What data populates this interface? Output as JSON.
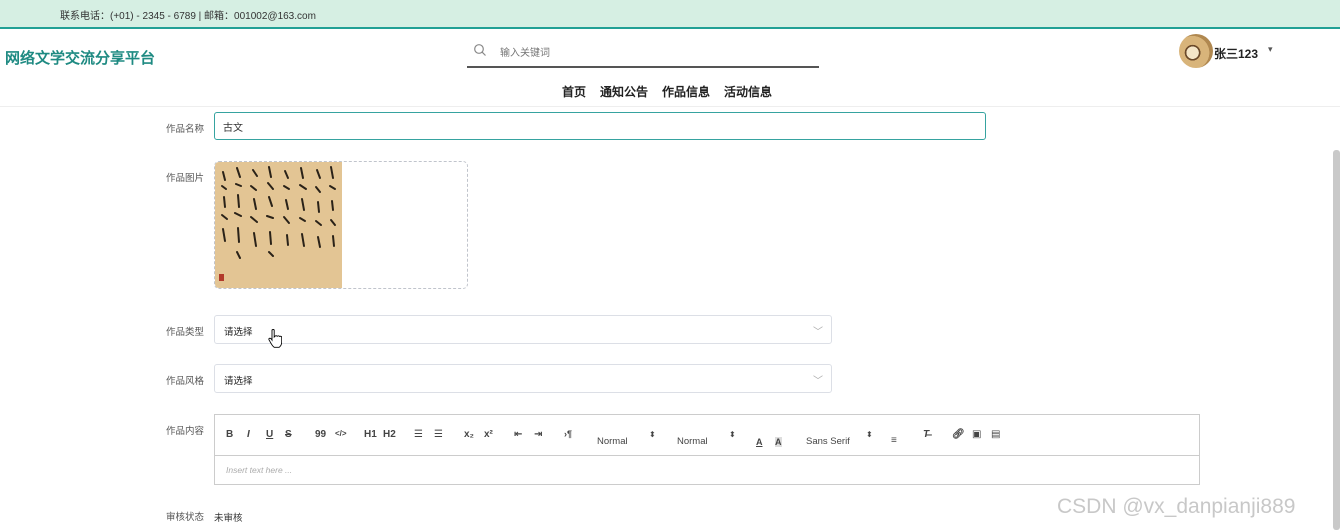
{
  "topbar": {
    "contact": "联系电话：(+01) - 2345 - 6789 | 邮箱：001002@163.com"
  },
  "header": {
    "logo": "网络文学交流分享平台",
    "search_placeholder": "输入关键词",
    "username": "张三123"
  },
  "nav": [
    "首页",
    "通知公告",
    "作品信息",
    "活动信息"
  ],
  "form": {
    "name_label": "作品名称",
    "name_value": "古文",
    "image_label": "作品图片",
    "type_label": "作品类型",
    "type_value": "请选择",
    "style_label": "作品风格",
    "style_value": "请选择",
    "content_label": "作品内容",
    "editor_placeholder": "Insert text here ...",
    "status_label": "审核状态",
    "status_value": "未审核"
  },
  "editor_toolbar": {
    "bold": "B",
    "italic": "I",
    "underline": "U",
    "strike": "S",
    "quote": "99",
    "code": "</>",
    "h1": "H1",
    "h2": "H2",
    "sub": "x₂",
    "sup": "x²",
    "header_select": "Normal",
    "size_select": "Normal",
    "font_select": "Sans Serif"
  },
  "watermark": "CSDN @vx_danpianji889",
  "colors": {
    "accent": "#1e8a82",
    "topbar_bg": "#d6efe3",
    "topbar_border": "#22a095",
    "input_focus": "#36a3a0"
  }
}
